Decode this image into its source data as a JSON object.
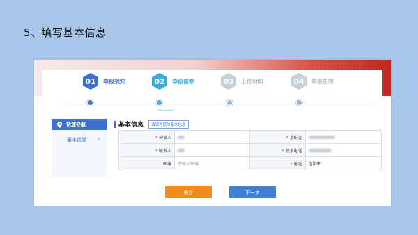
{
  "slide": {
    "title": "5、填写基本信息"
  },
  "steps": [
    {
      "num": "01",
      "label": "申报须知",
      "color": "#3f6fcf",
      "state": "done"
    },
    {
      "num": "02",
      "label": "申报信息",
      "color": "#3aaed8",
      "state": "active"
    },
    {
      "num": "03",
      "label": "上传材料",
      "color": "#c7cfdc",
      "state": "pending"
    },
    {
      "num": "04",
      "label": "申报告知",
      "color": "#c7cfdc",
      "state": "pending"
    }
  ],
  "sidebar": {
    "header": "快速导航",
    "header_icon": "location-pin-icon",
    "items": [
      {
        "label": "基本信息"
      }
    ]
  },
  "section": {
    "title": "基本信息",
    "tip": "请填写您的基本信息"
  },
  "form": {
    "required_marker": "*",
    "applicant_label": "申请人",
    "id_card_label": "身份证",
    "contact_label": "联系人",
    "phone_label": "联系电话",
    "postcode_label": "邮编",
    "postcode_placeholder": "请输入邮编",
    "address_label": "地址",
    "address_value": "信阳市"
  },
  "buttons": {
    "save": "保存",
    "next": "下一步"
  },
  "colors": {
    "primary": "#3f6fcf",
    "accent": "#3aaed8",
    "save": "#f08b1d",
    "banner_red": "#c0281f"
  }
}
